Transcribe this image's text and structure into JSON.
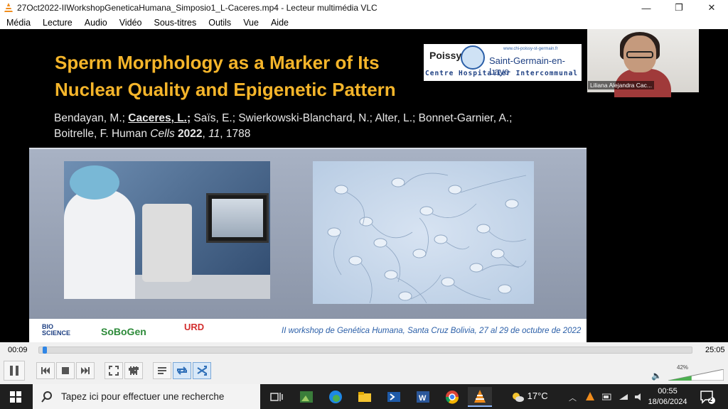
{
  "window": {
    "title": "27Oct2022-IIWorkshopGeneticaHumana_Simposio1_L-Caceres.mp4 - Lecteur multimédia VLC",
    "minimize": "—",
    "maximize": "❐",
    "close": "✕"
  },
  "menu": [
    "Média",
    "Lecture",
    "Audio",
    "Vidéo",
    "Sous-titres",
    "Outils",
    "Vue",
    "Aide"
  ],
  "slide": {
    "title_line1": "Sperm Morphology as a Marker of Its",
    "title_line2": "Nuclear Quality and Epigenetic Pattern",
    "authors_line1_pre": "Bendayan, M.; ",
    "authors_highlight": "Caceres, L.;",
    "authors_line1_post": " Saïs, E.; Swierkowski-Blanchard, N.; Alter, L.; Bonnet-Garnier, A.;",
    "authors_line2_pre": "Boitrelle, F. Human ",
    "journal": "Cells",
    "year": "2022",
    "volume": "11",
    "article": ", 1788",
    "logo_poissy": "Poissy",
    "logo_url": "www.chi-poissy-st-germain.fr",
    "logo_sgel": "Saint-Germain-en-Laye",
    "logo_chi": "Centre Hospitalier Intercommunal",
    "footer_bio": "BIO\nSCIENCE",
    "footer_sobogen": "SoBoGen",
    "footer_urd": "URD",
    "footer_workshop": "II workshop de Genética Humana, Santa Cruz Bolivia,  27 al 29 de octubre de 2022"
  },
  "speaker": {
    "name": "Liliana Alejandra Cac..."
  },
  "player": {
    "current_time": "00:09",
    "total_time": "25:05",
    "progress": 0.006,
    "volume": "42%",
    "volume_level": 0.42
  },
  "taskbar": {
    "search_placeholder": "Tapez ici pour effectuer une recherche",
    "temperature": "17°C",
    "time": "00:55",
    "date": "18/06/2024",
    "notifications": "2"
  }
}
